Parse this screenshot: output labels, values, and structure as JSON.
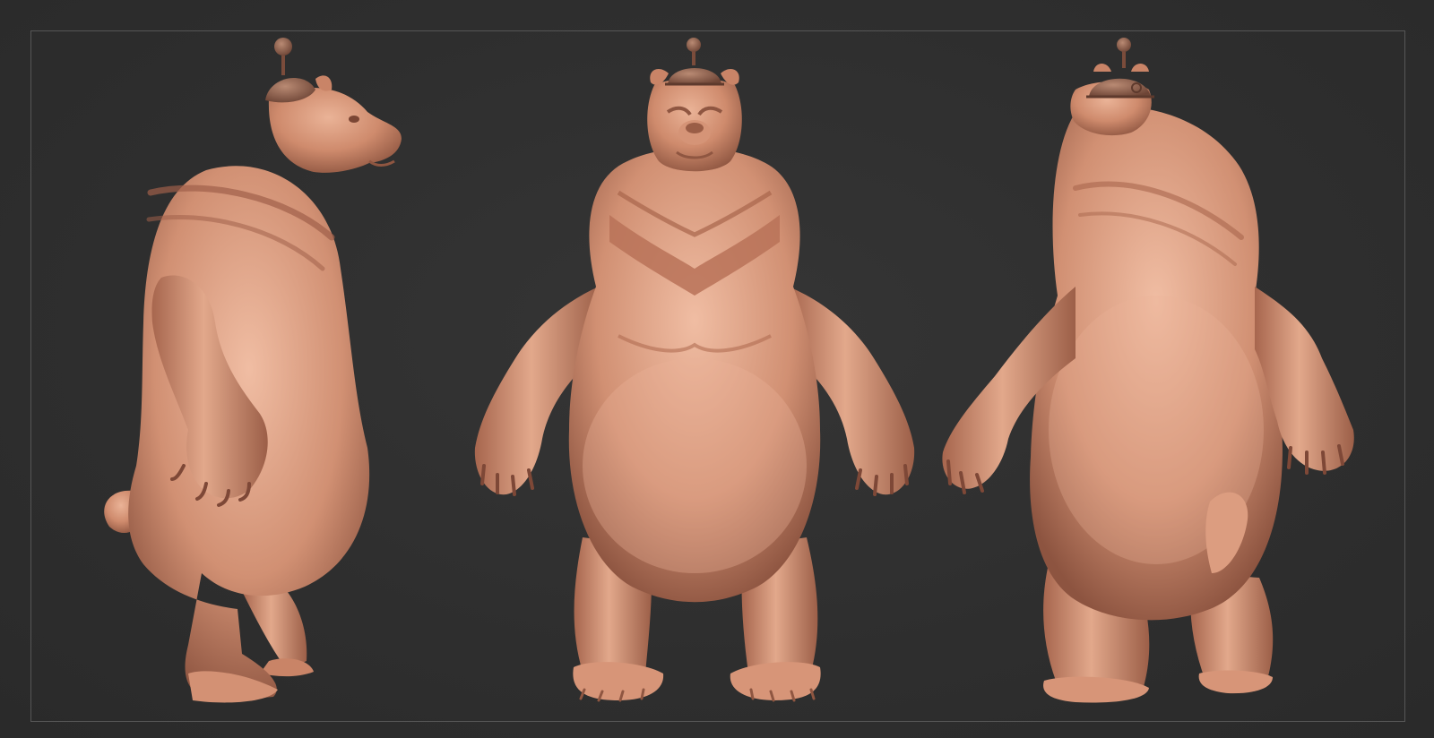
{
  "scene": {
    "views": [
      {
        "view": "side"
      },
      {
        "view": "front"
      },
      {
        "view": "back"
      }
    ],
    "colors": {
      "background": "#2f2f2f",
      "frame": "#565656",
      "clay_light": "#e3a98c",
      "clay_mid": "#c98467",
      "clay_dark": "#8f5641",
      "helmet": "#a06e58"
    }
  }
}
